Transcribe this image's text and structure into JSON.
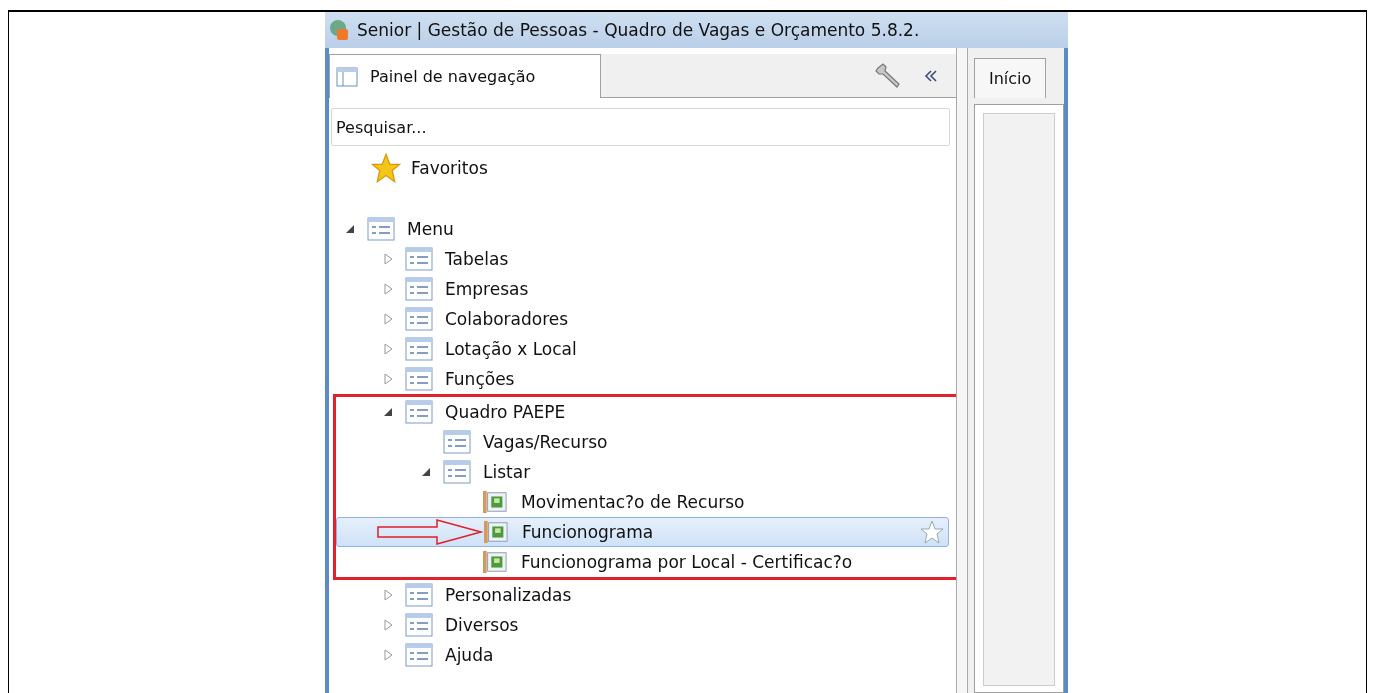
{
  "window": {
    "title": "Senior | Gestão de Pessoas - Quadro de Vagas e Orçamento 5.8.2."
  },
  "nav_panel": {
    "tab": "Painel de navegação",
    "search": {
      "placeholder": "Pesquisar..."
    },
    "favorites": "Favoritos",
    "tree": [
      {
        "label": "Menu",
        "kind": "folder",
        "expanded": true,
        "selected": false,
        "children": [
          {
            "label": "Tabelas",
            "kind": "folder",
            "expanded": false,
            "selected": false
          },
          {
            "label": "Empresas",
            "kind": "folder",
            "expanded": false,
            "selected": false
          },
          {
            "label": "Colaboradores",
            "kind": "folder",
            "expanded": false,
            "selected": false
          },
          {
            "label": "Lotação x Local",
            "kind": "folder",
            "expanded": false,
            "selected": false
          },
          {
            "label": "Funções",
            "kind": "folder",
            "expanded": false,
            "selected": false
          },
          {
            "label": "Quadro PAEPE",
            "kind": "folder",
            "expanded": true,
            "selected": false,
            "highlighted": true,
            "children": [
              {
                "label": "Vagas/Recurso",
                "kind": "folder",
                "selected": false
              },
              {
                "label": "Listar",
                "kind": "folder",
                "expanded": true,
                "selected": false,
                "children": [
                  {
                    "label": "Movimentac?o de Recurso",
                    "kind": "report",
                    "selected": false
                  },
                  {
                    "label": "Funcionograma",
                    "kind": "report",
                    "selected": true,
                    "arrow": true
                  },
                  {
                    "label": "Funcionograma por Local - Certificac?o",
                    "kind": "report",
                    "selected": false
                  }
                ]
              }
            ]
          },
          {
            "label": "Personalizadas",
            "kind": "folder",
            "expanded": false,
            "selected": false
          },
          {
            "label": "Diversos",
            "kind": "folder",
            "expanded": false,
            "selected": false
          },
          {
            "label": "Ajuda",
            "kind": "folder",
            "expanded": false,
            "selected": false
          }
        ]
      }
    ]
  },
  "right_tabs": [
    {
      "label": "Início",
      "selected": true
    }
  ]
}
